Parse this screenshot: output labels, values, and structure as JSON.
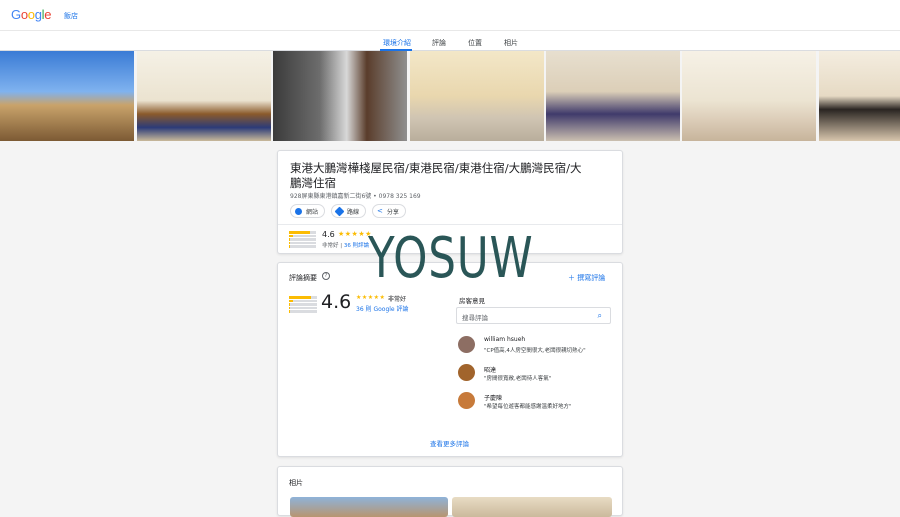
{
  "header": {
    "logo_text": "Google",
    "top_link": "飯店"
  },
  "tabs": [
    {
      "label": "環境介紹",
      "active": true
    },
    {
      "label": "評論",
      "active": false
    },
    {
      "label": "位置",
      "active": false
    },
    {
      "label": "相片",
      "active": false
    }
  ],
  "listing": {
    "title": "東港大鵬灣樺棧屋民宿/東港民宿/東港住宿/大鵬灣民宿/大鵬灣住宿",
    "address": "928屏東縣東港鎮嘉新二街6號 • 0978 325 169",
    "actions": [
      {
        "label": "網站",
        "icon": "globe-icon"
      },
      {
        "label": "路線",
        "icon": "directions-icon"
      },
      {
        "label": "分享",
        "icon": "share-icon"
      }
    ],
    "score": "4.6",
    "rating_word": "非常好",
    "reviews_link": "36 則評論",
    "stars": "★★★★★"
  },
  "review_summary": {
    "heading": "評論摘要",
    "write_review": "撰寫評論",
    "score": "4.6",
    "stars": "★★★★★",
    "rating_word": "非常好",
    "google_reviews": "36 則 Google 評論",
    "bar_fractions": [
      0.78,
      0.14,
      0.05,
      0.02,
      0.01
    ],
    "guest_opinions": "房客意見",
    "search_placeholder": "搜尋評論",
    "reviewers": [
      {
        "name": "william hsueh",
        "quote": "\"CP值高,4人房空間很大,老闆很親切熱心\"",
        "avatar_color": "#8d6e63"
      },
      {
        "name": "昭達",
        "quote": "\"房間很寬敞,老闆待人客氣\"",
        "avatar_color": "#a1642c"
      },
      {
        "name": "子慶陳",
        "quote": "\"希望每位遊客都能感謝溫柔好地方\"",
        "avatar_color": "#c77a3a"
      }
    ],
    "more_reviews": "查看更多評論"
  },
  "photos_section": {
    "heading": "相片"
  },
  "watermark": "YOSUW",
  "colors": {
    "link": "#1a73e8",
    "star": "#fbbc04"
  }
}
